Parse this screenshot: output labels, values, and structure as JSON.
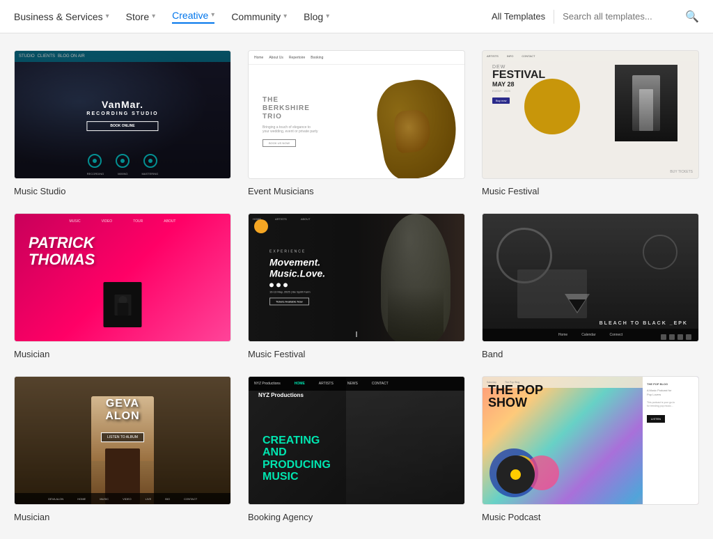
{
  "nav": {
    "items": [
      {
        "label": "Business & Services",
        "active": false,
        "hasChevron": true
      },
      {
        "label": "Store",
        "active": false,
        "hasChevron": true
      },
      {
        "label": "Creative",
        "active": true,
        "hasChevron": true
      },
      {
        "label": "Community",
        "active": false,
        "hasChevron": true
      },
      {
        "label": "Blog",
        "active": false,
        "hasChevron": true
      }
    ],
    "allTemplatesLabel": "All Templates",
    "searchPlaceholder": "Search all templates...",
    "searchIconLabel": "🔍"
  },
  "templates": [
    {
      "id": "music-studio",
      "label": "Music Studio",
      "thumb_type": "music-studio"
    },
    {
      "id": "event-musicians",
      "label": "Event Musicians",
      "thumb_type": "event-musicians"
    },
    {
      "id": "music-festival-1",
      "label": "Music Festival",
      "thumb_type": "music-festival-1"
    },
    {
      "id": "musician",
      "label": "Musician",
      "thumb_type": "musician"
    },
    {
      "id": "music-festival-2",
      "label": "Music Festival",
      "thumb_type": "music-festival-2"
    },
    {
      "id": "band",
      "label": "Band",
      "thumb_type": "band"
    },
    {
      "id": "musician-2",
      "label": "Musician",
      "thumb_type": "musician-2"
    },
    {
      "id": "booking-agency",
      "label": "Booking Agency",
      "thumb_type": "booking-agency"
    },
    {
      "id": "music-podcast",
      "label": "Music Podcast",
      "thumb_type": "music-podcast"
    }
  ]
}
